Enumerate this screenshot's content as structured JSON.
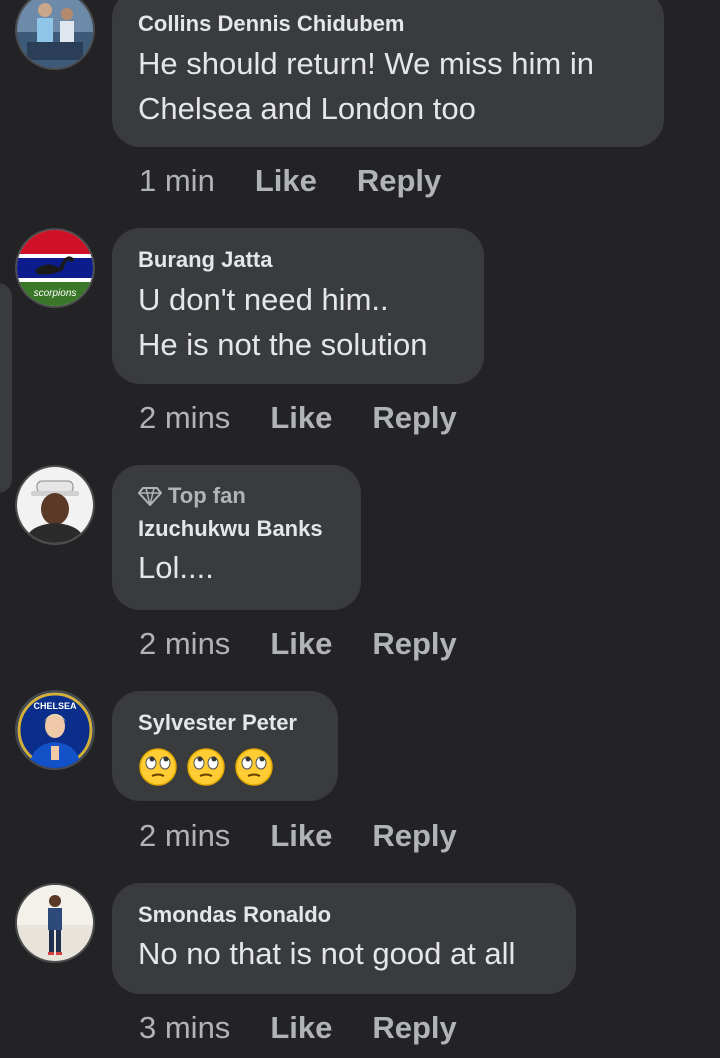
{
  "comments": [
    {
      "author": "Collins Dennis Chidubem",
      "text": "He should return! We miss him in\nChelsea and London too",
      "time": "1 min",
      "like": "Like",
      "reply": "Reply"
    },
    {
      "author": "Burang Jatta",
      "text": "U don't need him..\nHe is not the solution",
      "time": "2 mins",
      "like": "Like",
      "reply": "Reply",
      "avatar_text": "scorpions"
    },
    {
      "author": "Izuchukwu Banks",
      "badge": "Top fan",
      "text": "Lol....",
      "time": "2 mins",
      "like": "Like",
      "reply": "Reply"
    },
    {
      "author": "Sylvester Peter",
      "emojis": [
        "face-with-rolling-eyes",
        "face-with-rolling-eyes",
        "face-with-rolling-eyes"
      ],
      "time": "2 mins",
      "like": "Like",
      "reply": "Reply",
      "avatar_text": "CHELSEA"
    },
    {
      "author": "Smondas Ronaldo",
      "text": "No no that is not good at all",
      "time": "3 mins",
      "like": "Like",
      "reply": "Reply"
    }
  ],
  "colors": {
    "background": "#232325",
    "bubble": "#3a3b3c",
    "primary_text": "#e4e6eb",
    "secondary_text": "#b0b3b8"
  }
}
